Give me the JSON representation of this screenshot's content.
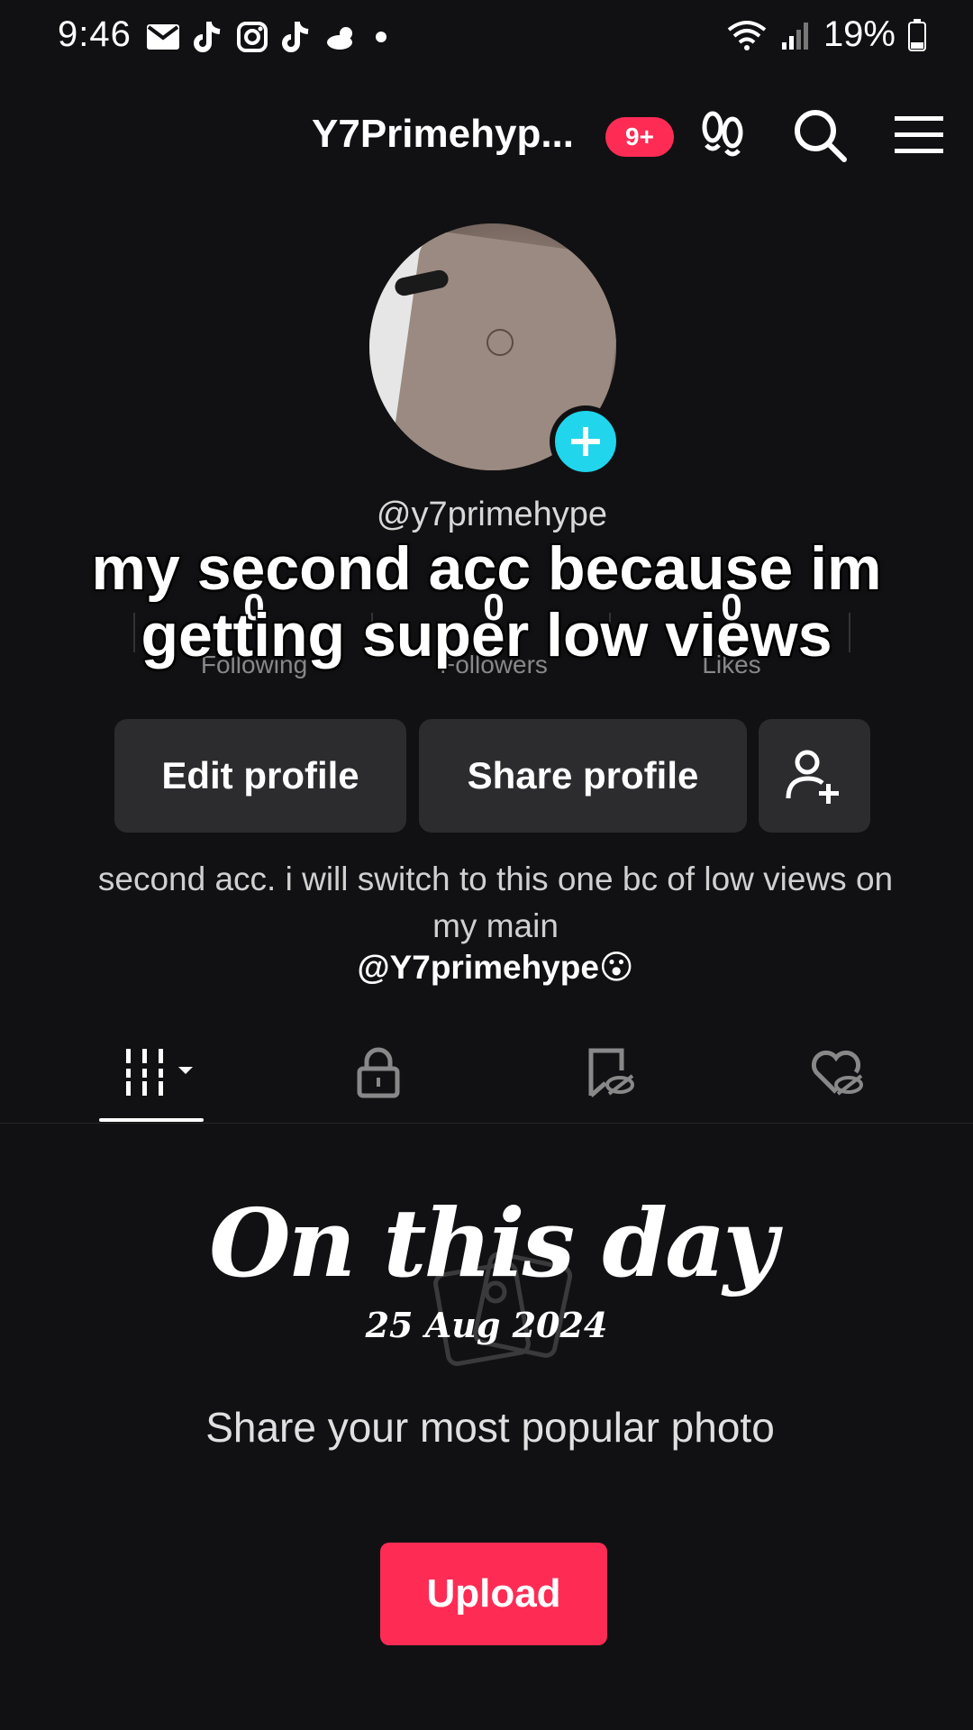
{
  "status_bar": {
    "time": "9:46",
    "battery": "19%",
    "notification_icons": [
      "mail-icon",
      "tiktok-icon",
      "instagram-icon",
      "tiktok-icon",
      "weather-icon",
      "dot-icon"
    ]
  },
  "header": {
    "title": "Y7Primehyp...",
    "badge": "9+"
  },
  "profile": {
    "username": "@y7primehype",
    "stats": [
      {
        "value": "0",
        "label": "Following"
      },
      {
        "value": "0",
        "label": "Followers"
      },
      {
        "value": "0",
        "label": "Likes"
      }
    ]
  },
  "caption": {
    "line1": "my second acc because im",
    "line2": "getting super low views"
  },
  "buttons": {
    "edit": "Edit profile",
    "share": "Share profile"
  },
  "bio": {
    "text": "second acc. i will switch to this one bc of low views on my main",
    "handle": "@Y7primehype😮"
  },
  "on_this_day": {
    "title": "On this day",
    "date": "25 Aug 2024",
    "prompt": "Share your most popular photo",
    "upload": "Upload"
  },
  "colors": {
    "background": "#111113",
    "accent": "#fe2c55",
    "avatar_plus": "#20d5ec",
    "button_bg": "#2c2c2e"
  }
}
